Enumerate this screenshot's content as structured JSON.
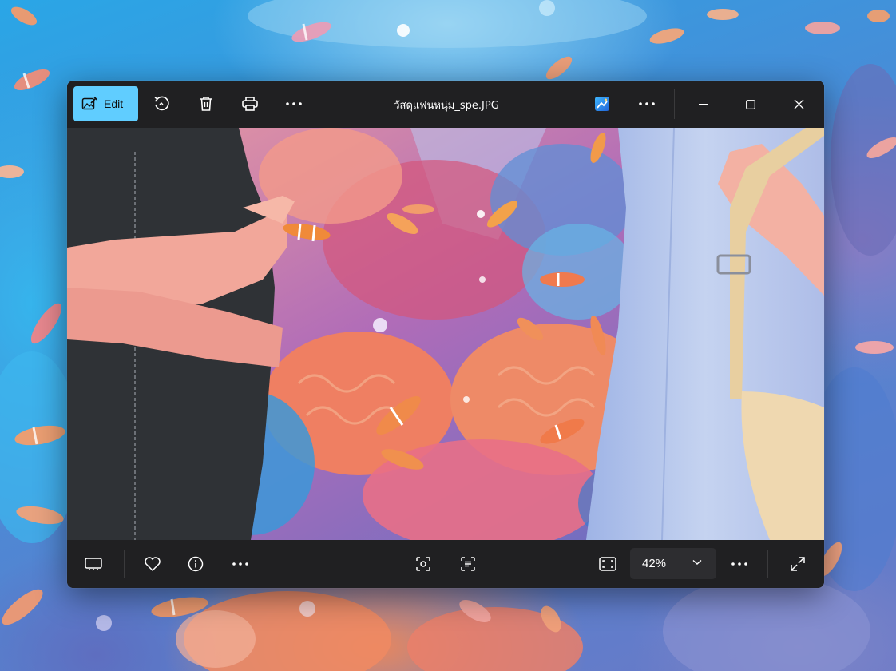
{
  "window": {
    "title": "วัสดุแฟนหนุ่ม_spe.JPG"
  },
  "toolbar": {
    "edit_label": "Edit"
  },
  "bottombar": {
    "zoom_value": "42%"
  },
  "colors": {
    "accent": "#60cdff",
    "window_bg": "#202022",
    "text": "#ffffff"
  },
  "icons": [
    "edit-image-icon",
    "rotate-icon",
    "delete-icon",
    "print-icon",
    "more-icon",
    "designer-icon",
    "minimize-icon",
    "maximize-icon",
    "close-icon",
    "filmstrip-icon",
    "favorite-icon",
    "info-icon",
    "visual-search-icon",
    "text-scan-icon",
    "fit-icon",
    "chevron-down-icon",
    "fullscreen-icon"
  ]
}
